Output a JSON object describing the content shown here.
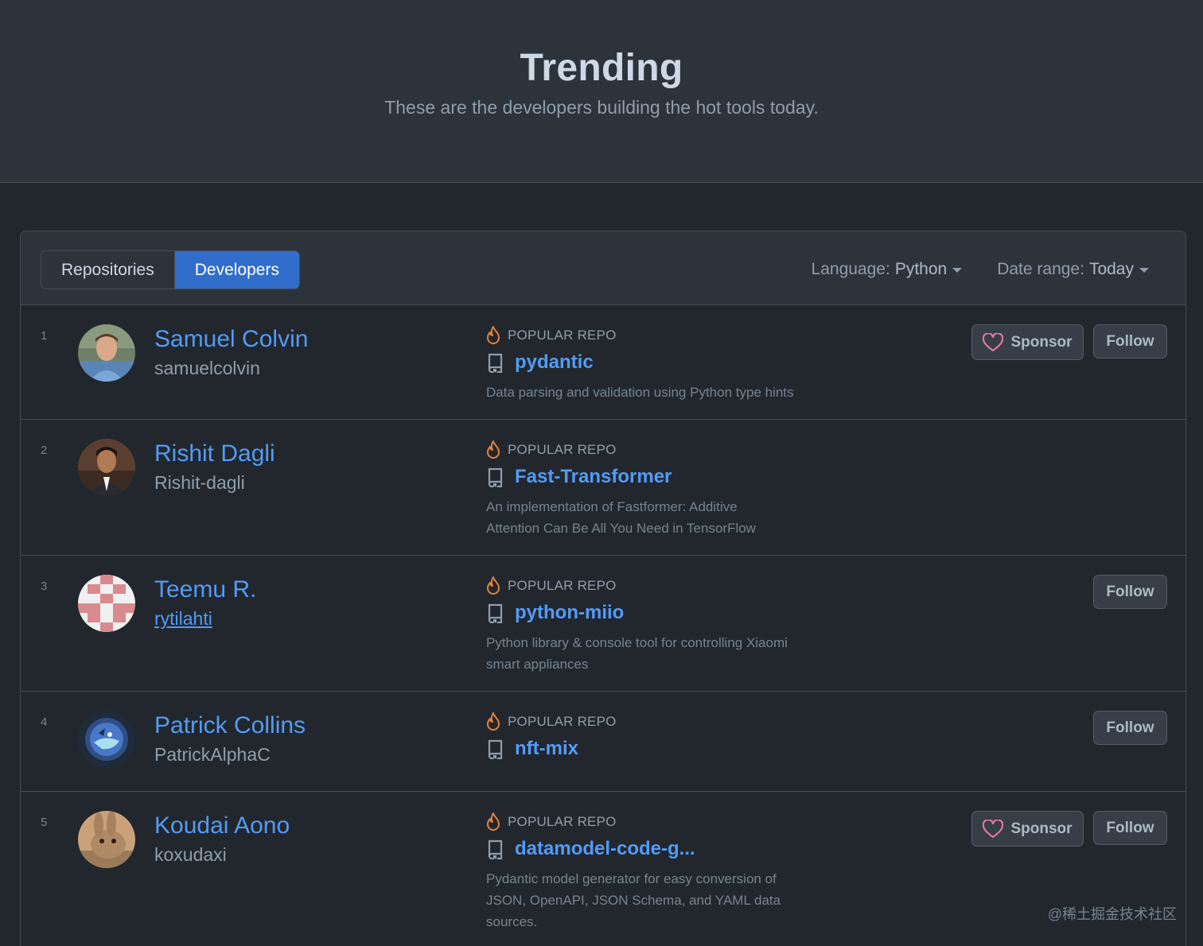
{
  "hero": {
    "title": "Trending",
    "subtitle": "These are the developers building the hot tools today."
  },
  "tabs": [
    {
      "label": "Repositories",
      "selected": false
    },
    {
      "label": "Developers",
      "selected": true
    }
  ],
  "filters": {
    "language_label": "Language:",
    "language_value": "Python",
    "date_label": "Date range:",
    "date_value": "Today"
  },
  "popular_repo_label": "POPULAR REPO",
  "buttons": {
    "sponsor": "Sponsor",
    "follow": "Follow"
  },
  "developers": [
    {
      "rank": "1",
      "name": "Samuel Colvin",
      "login": "samuelcolvin",
      "repo": "pydantic",
      "description": "Data parsing and validation using Python type hints",
      "sponsor": true,
      "follow": true
    },
    {
      "rank": "2",
      "name": "Rishit Dagli",
      "login": "Rishit-dagli",
      "repo": "Fast-Transformer",
      "description": "An implementation of Fastformer: Additive Attention Can Be All You Need in TensorFlow",
      "sponsor": false,
      "follow": false
    },
    {
      "rank": "3",
      "name": "Teemu R.",
      "login": "rytilahti",
      "repo": "python-miio",
      "description": "Python library & console tool for controlling Xiaomi smart appliances",
      "sponsor": false,
      "follow": true
    },
    {
      "rank": "4",
      "name": "Patrick Collins",
      "login": "PatrickAlphaC",
      "repo": "nft-mix",
      "description": "",
      "sponsor": false,
      "follow": true
    },
    {
      "rank": "5",
      "name": "Koudai Aono",
      "login": "koxudaxi",
      "repo": "datamodel-code-g...",
      "description": "Pydantic model generator for easy conversion of JSON, OpenAPI, JSON Schema, and YAML data sources.",
      "sponsor": true,
      "follow": true
    }
  ],
  "colors": {
    "accent": "#539bf5",
    "selected_tab": "#316dca",
    "flame": "#e0823d",
    "heart": "#e275ad"
  },
  "watermark": "@稀土掘金技术社区"
}
